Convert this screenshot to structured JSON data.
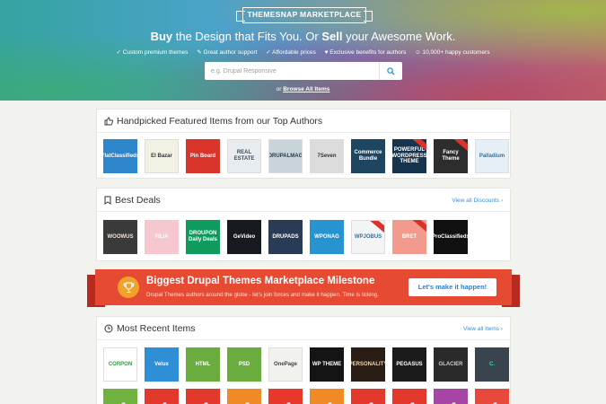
{
  "hero": {
    "logo": "THEMESNAP MARKETPLACE",
    "headline_buy": "Buy",
    "headline_mid": " the Design that Fits You. Or ",
    "headline_sell": "Sell",
    "headline_end": " your Awesome Work.",
    "features": [
      "✓ Custom premium themes",
      "✎ Great author support",
      "✓ Affordable prices",
      "♥ Exclusive benefits for authors",
      "☺ 10,000+ happy customers"
    ],
    "search_placeholder": "e.g. Drupal Responsive",
    "browse_prefix": "or ",
    "browse_link": "Browse All Items"
  },
  "featured": {
    "title": "Handpicked Featured Items from our Top Authors",
    "items": [
      {
        "label": "FlatClassifieds",
        "bg": "#2d86c9",
        "fg": "#ffffff"
      },
      {
        "label": "El Bazar",
        "bg": "#f3f1e4",
        "fg": "#333333"
      },
      {
        "label": "Pin Board",
        "bg": "#d8342a",
        "fg": "#ffffff"
      },
      {
        "label": "REAL ESTATE",
        "bg": "#e9ecef",
        "fg": "#3d4d5c"
      },
      {
        "label": "DRUPALMAG",
        "bg": "#c8d3da",
        "fg": "#2a3b48"
      },
      {
        "label": "7Seven",
        "bg": "#dcdcdc",
        "fg": "#333333"
      },
      {
        "label": "Commerce Bundle",
        "bg": "#1e4661",
        "fg": "#ffffff"
      },
      {
        "label": "POWERFUL WORDPRESS THEME",
        "bg": "#17344f",
        "fg": "#ffffff"
      },
      {
        "label": "Fancy Theme",
        "bg": "#2d2d2d",
        "fg": "#ffffff"
      },
      {
        "label": "Palladium",
        "bg": "#e6eef6",
        "fg": "#3b6e99"
      }
    ]
  },
  "deals": {
    "title": "Best Deals",
    "link": "View all Discounts ›",
    "items": [
      {
        "label": "WOOWUS",
        "bg": "#3a3a3a",
        "fg": "#f0e7d5"
      },
      {
        "label": "FILIA",
        "bg": "#f6c7cf",
        "fg": "#ffffff"
      },
      {
        "label": "DROUPON Daily Deals",
        "bg": "#0f9a5e",
        "fg": "#ffffff"
      },
      {
        "label": "GeVideo",
        "bg": "#161a1f",
        "fg": "#ffffff"
      },
      {
        "label": "DRUPADS",
        "bg": "#2a3c55",
        "fg": "#ffffff"
      },
      {
        "label": "WPONAG",
        "bg": "#2793d1",
        "fg": "#ffffff"
      },
      {
        "label": "WPJOBUS",
        "bg": "#f3f4f6",
        "fg": "#3b6e99"
      },
      {
        "label": "BRET",
        "bg": "#f29a8e",
        "fg": "#ffffff"
      },
      {
        "label": "ProClassifieds",
        "bg": "#111111",
        "fg": "#ffffff"
      }
    ]
  },
  "banner": {
    "title": "Biggest Drupal Themes Marketplace Milestone",
    "subtitle": "Drupal Themes authors around the globe - let's join forces and make it happen. Time is ticking.",
    "button": "Let's make it happen!"
  },
  "recent": {
    "title": "Most Recent Items",
    "link": "View all Items ›",
    "items": [
      {
        "label": "CORPON",
        "bg": "#ffffff",
        "fg": "#2f9a43"
      },
      {
        "label": "Velux",
        "bg": "#2e8fd6",
        "fg": "#ffffff"
      },
      {
        "label": "HTML",
        "bg": "#6aac3d",
        "fg": "#ffffff"
      },
      {
        "label": "PSD",
        "bg": "#6aac3d",
        "fg": "#ffffff"
      },
      {
        "label": "OnePage",
        "bg": "#f1f1ee",
        "fg": "#444444"
      },
      {
        "label": "WP THEME",
        "bg": "#141414",
        "fg": "#ffffff"
      },
      {
        "label": "PERSONALITY",
        "bg": "#2a1d16",
        "fg": "#f2d6a8"
      },
      {
        "label": "PEGASUS",
        "bg": "#1b1b1b",
        "fg": "#ffffff"
      },
      {
        "label": "GLACIER",
        "bg": "#2a2a2a",
        "fg": "#cccccc"
      },
      {
        "label": "C.",
        "bg": "#39444e",
        "fg": "#2ee0b0"
      }
    ],
    "row2_colors": [
      "#6fb23f",
      "#e3382c",
      "#e3382c",
      "#f08a27",
      "#e8382c",
      "#f08a27",
      "#e3382c",
      "#e3382c",
      "#a745a6",
      "#e74a3c"
    ]
  },
  "colors": {
    "accent_blue": "#3b8fd1",
    "banner_red": "#e64a33",
    "trophy_orange": "#f0a22a"
  }
}
